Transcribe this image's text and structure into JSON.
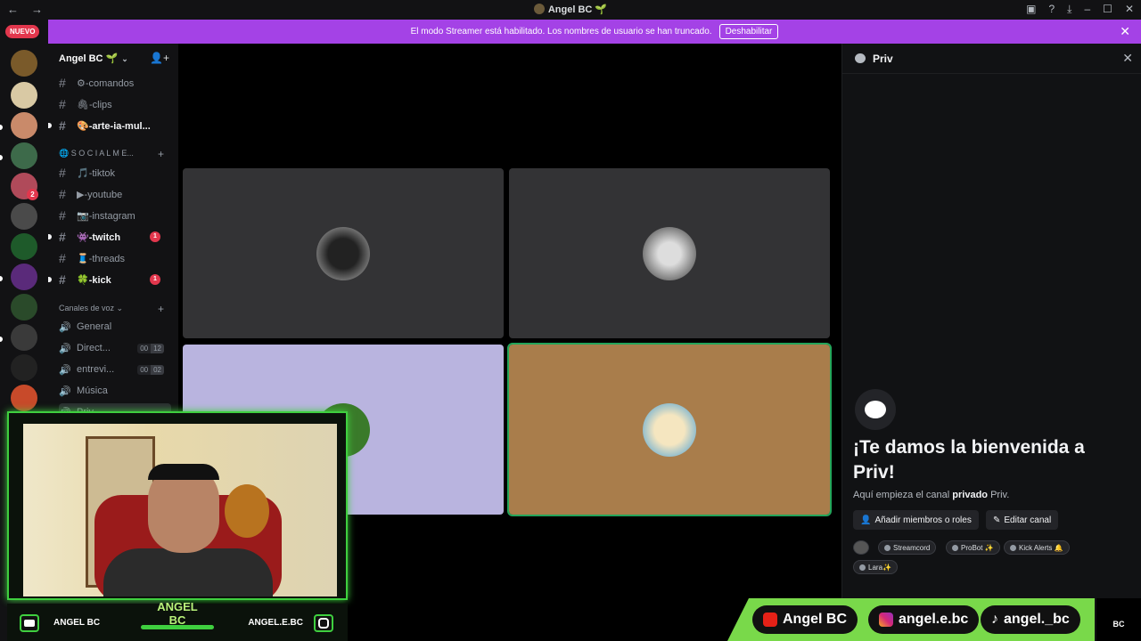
{
  "titlebar": {
    "back": "←",
    "forward": "→",
    "title": "Angel BC 🌱",
    "inbox_icon": "inbox-icon",
    "help_icon": "help-icon",
    "download_icon": "download-icon",
    "minimize": "–",
    "maximize": "☐",
    "close": "✕"
  },
  "banner": {
    "text": "El modo Streamer está habilitado. Los nombres de usuario se han truncado.",
    "button": "Deshabilitar",
    "close": "✕",
    "color": "#a442e6"
  },
  "rail": {
    "new_badge": "NUEVO",
    "mention_badge": "2"
  },
  "sidebar": {
    "server_name": "Angel BC 🌱",
    "chevron": "⌄",
    "channels": [
      {
        "label": "⚙-comandos"
      },
      {
        "label": "🖇-clips"
      },
      {
        "label": "🎨-arte-ia-mul..."
      }
    ],
    "category_social": "🌐 S O C I A L M E...",
    "social_channels": [
      {
        "label": "🎵-tiktok"
      },
      {
        "label": "▶-youtube"
      },
      {
        "label": "📷-instagram"
      },
      {
        "label": "👾-twitch",
        "badge": "1"
      },
      {
        "label": "🧵-threads"
      },
      {
        "label": "🍀-kick",
        "badge": "1"
      }
    ],
    "category_voice": "Canales de voz ⌄",
    "voice_channels": [
      {
        "label": "General"
      },
      {
        "label": "Direct...",
        "a": "00",
        "b": "12"
      },
      {
        "label": "entrevi...",
        "a": "00",
        "b": "02"
      },
      {
        "label": "Música"
      },
      {
        "label": "Priv"
      }
    ]
  },
  "panel": {
    "title": "Priv",
    "close": "✕",
    "welcome_title": "¡Te damos la bienvenida a Priv!",
    "welcome_sub_pre": "Aquí empieza el canal ",
    "welcome_sub_bold": "privado",
    "welcome_sub_post": " Priv.",
    "add_members": "Añadir miembros o roles",
    "edit_channel": "Editar canal",
    "tags": [
      "Streamcord",
      "ProBot ✨",
      "Kick Alerts 🔔",
      "Lara✨"
    ]
  },
  "overlay": {
    "name": "ANGEL BC",
    "left_handle": "ANGEL BC",
    "right_handle": "ANGEL.E.BC",
    "accent": "#3fcf3f"
  },
  "socials": {
    "youtube": "Angel BC",
    "instagram": "angel.e.bc",
    "tiktok": "angel._bc",
    "logo": "BC"
  }
}
